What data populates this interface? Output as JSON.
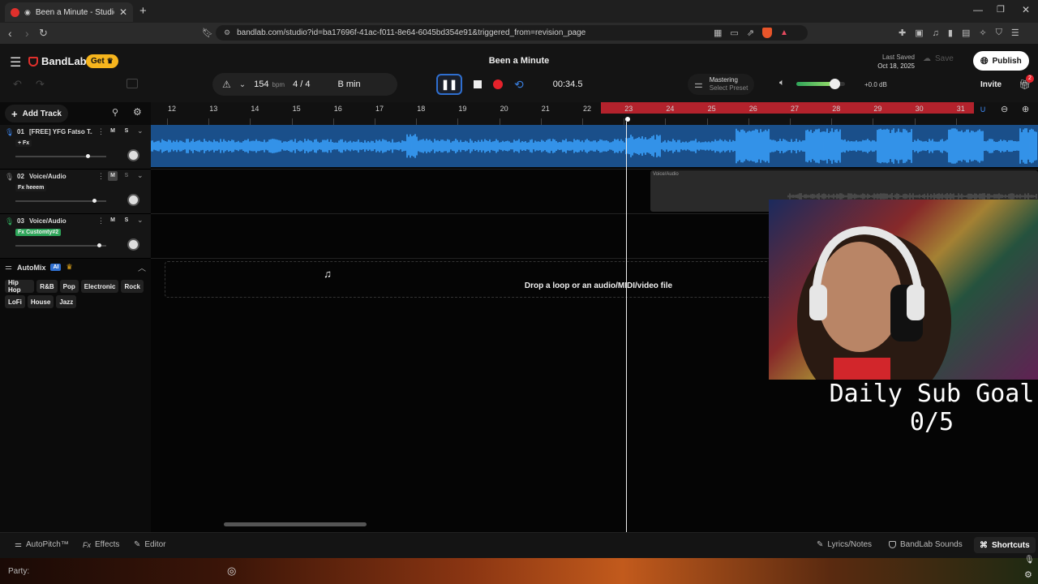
{
  "browser": {
    "tab_title": "Been a Minute - Studio",
    "new_tab": "+",
    "url": "bandlab.com/studio?id=ba17696f-41ac-f011-8e64-6045bd354e91&triggered_from=revision_page"
  },
  "app": {
    "brand": "BandLab",
    "get_label": "Get",
    "project_title": "Been a Minute",
    "last_saved_label": "Last Saved",
    "last_saved_date": "Oct 18, 2025",
    "save_label": "Save",
    "publish_label": "Publish",
    "invite_label": "Invite",
    "invite_badge": "2"
  },
  "transport": {
    "bpm": "154",
    "bpm_unit": "bpm",
    "time_signature": "4 / 4",
    "key": "B min",
    "time": "00:34.5",
    "mastering_label": "Mastering",
    "mastering_preset": "Select Preset",
    "volume_db": "+0.0 dB",
    "volume_level": 0.78
  },
  "ruler": {
    "add_track": "Add Track",
    "bars": [
      "12",
      "13",
      "14",
      "15",
      "16",
      "17",
      "18",
      "19",
      "20",
      "21",
      "22",
      "23",
      "24",
      "25",
      "26",
      "27",
      "28",
      "29",
      "30",
      "31"
    ]
  },
  "tracks": [
    {
      "number": "01",
      "name": "[FREE] YFG Fatso T...",
      "fx": "+ Fx",
      "mute": "M",
      "solo": "S",
      "volume": 0.78
    },
    {
      "number": "02",
      "name": "Voice/Audio",
      "fx": "Fx heeem",
      "mute": "M",
      "solo": "S",
      "volume": 0.85
    },
    {
      "number": "03",
      "name": "Voice/Audio",
      "fx": "Fx Customty#2",
      "mute": "M",
      "solo": "S",
      "volume": 0.9
    }
  ],
  "region_label": "Voice/Audio",
  "drop_zone": "Drop a loop or an audio/MIDI/video file",
  "automix": {
    "title": "AutoMix",
    "ai_badge": "AI",
    "genres_row1": [
      "Hip Hop",
      "R&B",
      "Pop",
      "Electronic",
      "Rock"
    ],
    "genres_row2": [
      "LoFi",
      "House",
      "Jazz"
    ]
  },
  "bottom": {
    "autopitch": "AutoPitch™",
    "effects": "Effects",
    "editor": "Editor",
    "lyrics": "Lyrics/Notes",
    "sounds": "BandLab Sounds",
    "shortcuts": "Shortcuts"
  },
  "overlay": {
    "sub_goal_title": "Daily Sub Goal",
    "sub_goal_count": "0/5",
    "party_label": "Party:"
  },
  "colors": {
    "accent_blue": "#2f6fd0",
    "waveform": "#3aa3ff",
    "loop_red": "#b3222c",
    "record_red": "#e5222b",
    "brand_red": "#e0302c",
    "get_yellow": "#f6b51d"
  }
}
